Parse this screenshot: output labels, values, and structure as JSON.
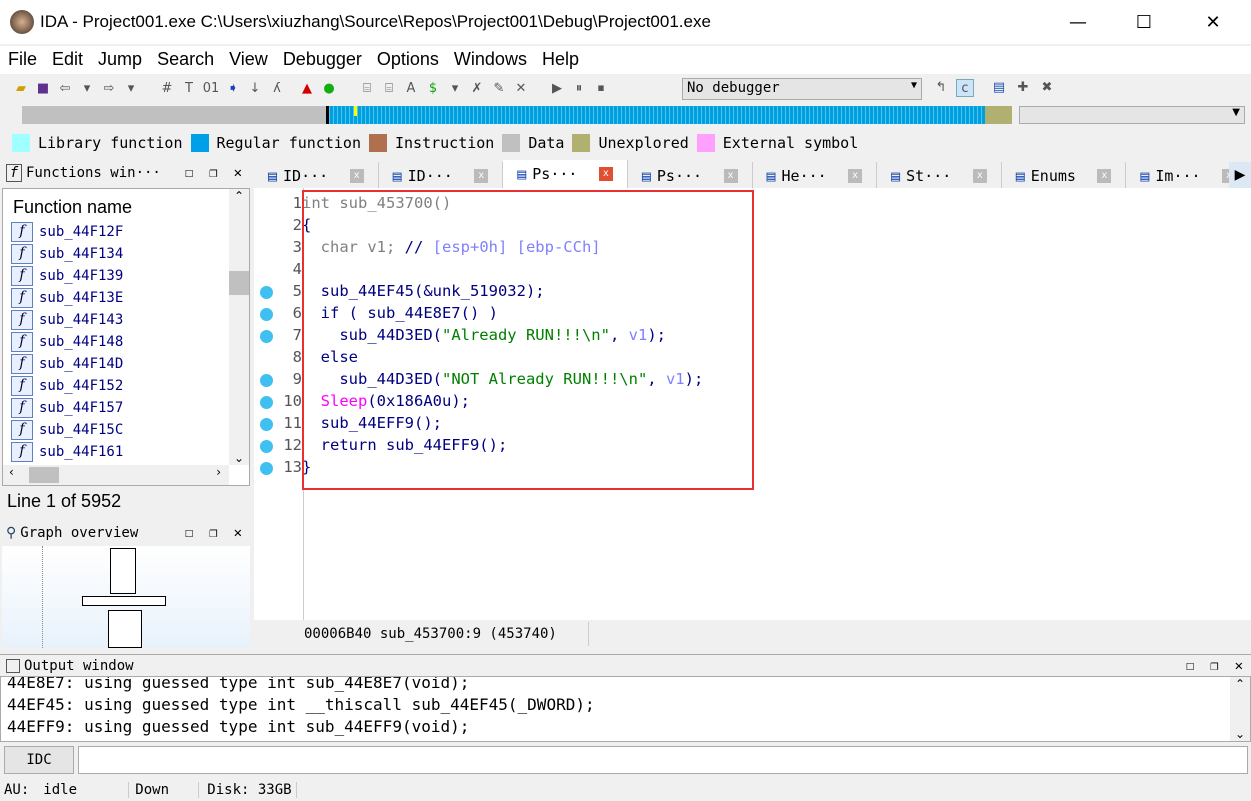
{
  "window": {
    "title": "IDA - Project001.exe C:\\Users\\xiuzhang\\Source\\Repos\\Project001\\Debug\\Project001.exe",
    "minimize": "—",
    "maximize": "☐",
    "close": "✕"
  },
  "menu": [
    "File",
    "Edit",
    "Jump",
    "Search",
    "View",
    "Debugger",
    "Options",
    "Windows",
    "Help"
  ],
  "toolbar": {
    "debugger_select": "No debugger"
  },
  "legend": [
    {
      "label": "Library function",
      "color": "#a0ffff"
    },
    {
      "label": "Regular function",
      "color": "#00a0e8"
    },
    {
      "label": "Instruction",
      "color": "#b07050"
    },
    {
      "label": "Data",
      "color": "#c0c0c0"
    },
    {
      "label": "Unexplored",
      "color": "#b0b070"
    },
    {
      "label": "External symbol",
      "color": "#ffa0ff"
    }
  ],
  "functions_window": {
    "title": "Functions win···",
    "column": "Function name",
    "items": [
      "sub_44F12F",
      "sub_44F134",
      "sub_44F139",
      "sub_44F13E",
      "sub_44F143",
      "sub_44F148",
      "sub_44F14D",
      "sub_44F152",
      "sub_44F157",
      "sub_44F15C",
      "sub_44F161"
    ],
    "line_status": "Line 1 of 5952"
  },
  "graph_overview": {
    "title": "Graph overview"
  },
  "tabs": [
    {
      "label": "ID···",
      "icon": "ida-view-icon"
    },
    {
      "label": "ID···",
      "icon": "ida-view-icon"
    },
    {
      "label": "Ps···",
      "icon": "pseudocode-icon",
      "active": true
    },
    {
      "label": "Ps···",
      "icon": "pseudocode-icon"
    },
    {
      "label": "He···",
      "icon": "hex-icon"
    },
    {
      "label": "St···",
      "icon": "structures-icon"
    },
    {
      "label": "Enums",
      "icon": "enums-icon"
    },
    {
      "label": "Im···",
      "icon": "imports-icon"
    }
  ],
  "code": {
    "lines": [
      {
        "n": "1",
        "dot": false,
        "parts": [
          [
            "g",
            "int sub_453700()"
          ]
        ]
      },
      {
        "n": "2",
        "dot": false,
        "parts": [
          [
            "b",
            "{"
          ]
        ]
      },
      {
        "n": "3",
        "dot": false,
        "parts": [
          [
            "g",
            "  char v1; "
          ],
          [
            "b",
            "// "
          ],
          [
            "p",
            "[esp+0h] [ebp-CCh]"
          ]
        ]
      },
      {
        "n": "4",
        "dot": false,
        "parts": []
      },
      {
        "n": "5",
        "dot": true,
        "parts": [
          [
            "b",
            "  sub_44EF45(&unk_519032);"
          ]
        ]
      },
      {
        "n": "6",
        "dot": true,
        "parts": [
          [
            "b",
            "  if ( sub_44E8E7() )"
          ]
        ]
      },
      {
        "n": "7",
        "dot": true,
        "parts": [
          [
            "b",
            "    sub_44D3ED("
          ],
          [
            "s",
            "\"Already RUN!!!\\n\""
          ],
          [
            "b",
            ", "
          ],
          [
            "p",
            "v1"
          ],
          [
            "b",
            ");"
          ]
        ]
      },
      {
        "n": "8",
        "dot": false,
        "parts": [
          [
            "b",
            "  else"
          ]
        ]
      },
      {
        "n": "9",
        "dot": true,
        "parts": [
          [
            "b",
            "    sub_44D3ED("
          ],
          [
            "s",
            "\"NOT Already RUN!!!\\n\""
          ],
          [
            "b",
            ", "
          ],
          [
            "p",
            "v1"
          ],
          [
            "b",
            ");"
          ]
        ]
      },
      {
        "n": "10",
        "dot": true,
        "parts": [
          [
            "b",
            "  "
          ],
          [
            "m",
            "Sleep"
          ],
          [
            "b",
            "(0x186A0u);"
          ]
        ]
      },
      {
        "n": "11",
        "dot": true,
        "parts": [
          [
            "b",
            "  sub_44EFF9();"
          ]
        ]
      },
      {
        "n": "12",
        "dot": true,
        "parts": [
          [
            "b",
            "  return sub_44EFF9();"
          ]
        ]
      },
      {
        "n": "13",
        "dot": true,
        "parts": [
          [
            "b",
            "}"
          ]
        ]
      }
    ],
    "status": "00006B40 sub_453700:9 (453740)",
    "highlight_color": "#e83030"
  },
  "output_window": {
    "title": "Output window",
    "lines": [
      "44E8E7: using guessed type int sub_44E8E7(void);",
      "44EF45: using guessed type int __thiscall sub_44EF45(_DWORD);",
      "44EFF9: using guessed type int sub_44EFF9(void);"
    ],
    "idc_button": "IDC",
    "input_value": ""
  },
  "statusbar": {
    "au": "AU:",
    "state": "idle",
    "direction": "Down",
    "disk": "Disk: 33GB"
  }
}
